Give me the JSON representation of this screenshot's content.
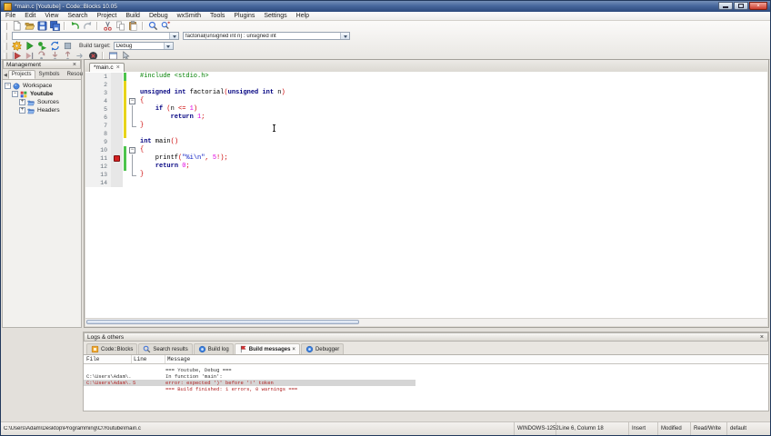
{
  "window": {
    "title": "*main.c [Youtube] - Code::Blocks 10.05"
  },
  "menu_bar": {
    "items": [
      "File",
      "Edit",
      "View",
      "Search",
      "Project",
      "Build",
      "Debug",
      "wxSmith",
      "Tools",
      "Plugins",
      "Settings",
      "Help"
    ]
  },
  "toolbar_main": {
    "icons": [
      "new-file",
      "open-file",
      "save",
      "save-all",
      "sep",
      "undo",
      "redo",
      "sep",
      "cut",
      "copy",
      "paste",
      "sep",
      "find",
      "replace"
    ]
  },
  "toolbar_code_completion": {
    "scope_combo_value": "",
    "function_combo_value": "factorial(unsigned int n) : unsigned int"
  },
  "toolbar_compiler": {
    "icons": [
      "build",
      "run",
      "build-run",
      "rebuild",
      "abort"
    ],
    "build_target_label": "Build target:",
    "build_target_value": "Debug"
  },
  "toolbar_debugger": {
    "icons": [
      "dbg-continue",
      "dbg-run-to-cursor",
      "dbg-next-line",
      "dbg-step-into",
      "dbg-step-out",
      "dbg-next-inst",
      "dbg-stop",
      "sep",
      "dbg-windows",
      "dbg-info"
    ]
  },
  "management": {
    "title": "Management",
    "tabs": [
      {
        "label": "Projects",
        "active": true
      },
      {
        "label": "Symbols",
        "active": false
      },
      {
        "label": "Resou",
        "active": false
      }
    ],
    "tree": [
      {
        "label": "Workspace",
        "icon": "workspace-icon",
        "level": 0,
        "expander": "minus",
        "bold": false
      },
      {
        "label": "Youtube",
        "icon": "project-icon",
        "level": 1,
        "expander": "minus",
        "bold": true
      },
      {
        "label": "Sources",
        "icon": "folder-icon",
        "level": 2,
        "expander": "plus",
        "bold": false
      },
      {
        "label": "Headers",
        "icon": "folder-icon",
        "level": 2,
        "expander": "plus",
        "bold": false
      }
    ]
  },
  "editor": {
    "tab_label": "*main.c",
    "lines": [
      {
        "num": 1,
        "bar": "green",
        "fold": "",
        "tokens": [
          {
            "c": "pre",
            "t": "#include <stdio.h>"
          }
        ]
      },
      {
        "num": 2,
        "bar": "yellow",
        "fold": "",
        "tokens": []
      },
      {
        "num": 3,
        "bar": "yellow",
        "fold": "",
        "tokens": [
          {
            "c": "kw",
            "t": "unsigned int"
          },
          {
            "c": "id",
            "t": " factorial"
          },
          {
            "c": "op",
            "t": "("
          },
          {
            "c": "kw",
            "t": "unsigned int"
          },
          {
            "c": "id",
            "t": " n"
          },
          {
            "c": "op",
            "t": ")"
          }
        ]
      },
      {
        "num": 4,
        "bar": "yellow",
        "fold": "box",
        "tokens": [
          {
            "c": "op",
            "t": "{"
          }
        ]
      },
      {
        "num": 5,
        "bar": "yellow",
        "fold": "line",
        "tokens": [
          {
            "c": "id",
            "t": "    "
          },
          {
            "c": "kw",
            "t": "if"
          },
          {
            "c": "id",
            "t": " "
          },
          {
            "c": "op",
            "t": "("
          },
          {
            "c": "id",
            "t": "n "
          },
          {
            "c": "op",
            "t": "<="
          },
          {
            "c": "num",
            "t": " 1"
          },
          {
            "c": "op",
            "t": ")"
          }
        ]
      },
      {
        "num": 6,
        "bar": "yellow",
        "fold": "line",
        "tokens": [
          {
            "c": "id",
            "t": "        "
          },
          {
            "c": "kw",
            "t": "return"
          },
          {
            "c": "num",
            "t": " 1"
          },
          {
            "c": "op",
            "t": ";"
          }
        ]
      },
      {
        "num": 7,
        "bar": "yellow",
        "fold": "end",
        "tokens": [
          {
            "c": "op",
            "t": "}"
          }
        ]
      },
      {
        "num": 8,
        "bar": "yellow",
        "fold": "",
        "tokens": []
      },
      {
        "num": 9,
        "bar": "",
        "fold": "",
        "tokens": [
          {
            "c": "kw",
            "t": "int"
          },
          {
            "c": "id",
            "t": " main"
          },
          {
            "c": "op",
            "t": "()"
          }
        ]
      },
      {
        "num": 10,
        "bar": "green",
        "fold": "box",
        "tokens": [
          {
            "c": "op",
            "t": "{"
          }
        ]
      },
      {
        "num": 11,
        "bar": "green",
        "fold": "line",
        "breakpoint": true,
        "tokens": [
          {
            "c": "id",
            "t": "    printf"
          },
          {
            "c": "op",
            "t": "("
          },
          {
            "c": "str",
            "t": "\"%i\\n\""
          },
          {
            "c": "op",
            "t": ","
          },
          {
            "c": "num",
            "t": " 5"
          },
          {
            "c": "op",
            "t": "!);"
          }
        ]
      },
      {
        "num": 12,
        "bar": "green",
        "fold": "line",
        "tokens": [
          {
            "c": "id",
            "t": "    "
          },
          {
            "c": "kw",
            "t": "return"
          },
          {
            "c": "num",
            "t": " 0"
          },
          {
            "c": "op",
            "t": ";"
          }
        ]
      },
      {
        "num": 13,
        "bar": "",
        "fold": "end",
        "tokens": [
          {
            "c": "op",
            "t": "}"
          }
        ]
      },
      {
        "num": 14,
        "bar": "",
        "fold": "",
        "tokens": []
      }
    ]
  },
  "logs_panel": {
    "title": "Logs & others",
    "tabs": [
      {
        "label": "Code::Blocks",
        "icon": "codeblocks-icon",
        "active": false,
        "closable": false
      },
      {
        "label": "Search results",
        "icon": "search-icon",
        "active": false,
        "closable": false
      },
      {
        "label": "Build log",
        "icon": "buildlog-icon",
        "active": false,
        "closable": false
      },
      {
        "label": "Build messages",
        "icon": "buildmsg-icon",
        "active": true,
        "closable": true
      },
      {
        "label": "Debugger",
        "icon": "debugger-icon",
        "active": false,
        "closable": false
      }
    ],
    "table": {
      "columns": [
        "File",
        "Line",
        "Message"
      ],
      "rows": [
        {
          "file": "",
          "line": "",
          "message": "=== Youtube, Debug ===",
          "error": false,
          "selected": false
        },
        {
          "file": "C:\\Users\\Adam\\...",
          "line": "",
          "message": "In function 'main':",
          "error": false,
          "selected": false
        },
        {
          "file": "C:\\Users\\Adam\\...",
          "line": "5",
          "message": "error: expected ')' before '!' token",
          "error": true,
          "selected": true
        },
        {
          "file": "",
          "line": "",
          "message": "=== Build finished: 1 errors, 0 warnings ===",
          "error": true,
          "selected": false
        }
      ]
    }
  },
  "status_bar": {
    "path": "C:\\Users\\Adam\\Desktop\\Programming\\C\\Youtube\\main.c",
    "encoding": "WINDOWS-1252",
    "caret": "Line 6, Column 18",
    "insert_mode": "Insert",
    "modified": "Modified",
    "permissions": "Read/Write",
    "profile": "default"
  },
  "colors": {
    "keyword": "#000080",
    "preprocessor": "#008000",
    "string": "#0013c0",
    "number": "#e000e0",
    "operator": "#cc0000",
    "breakpoint": "#d42020",
    "changebar_saved": "#4cc44c",
    "changebar_unsaved": "#e8d41a"
  }
}
